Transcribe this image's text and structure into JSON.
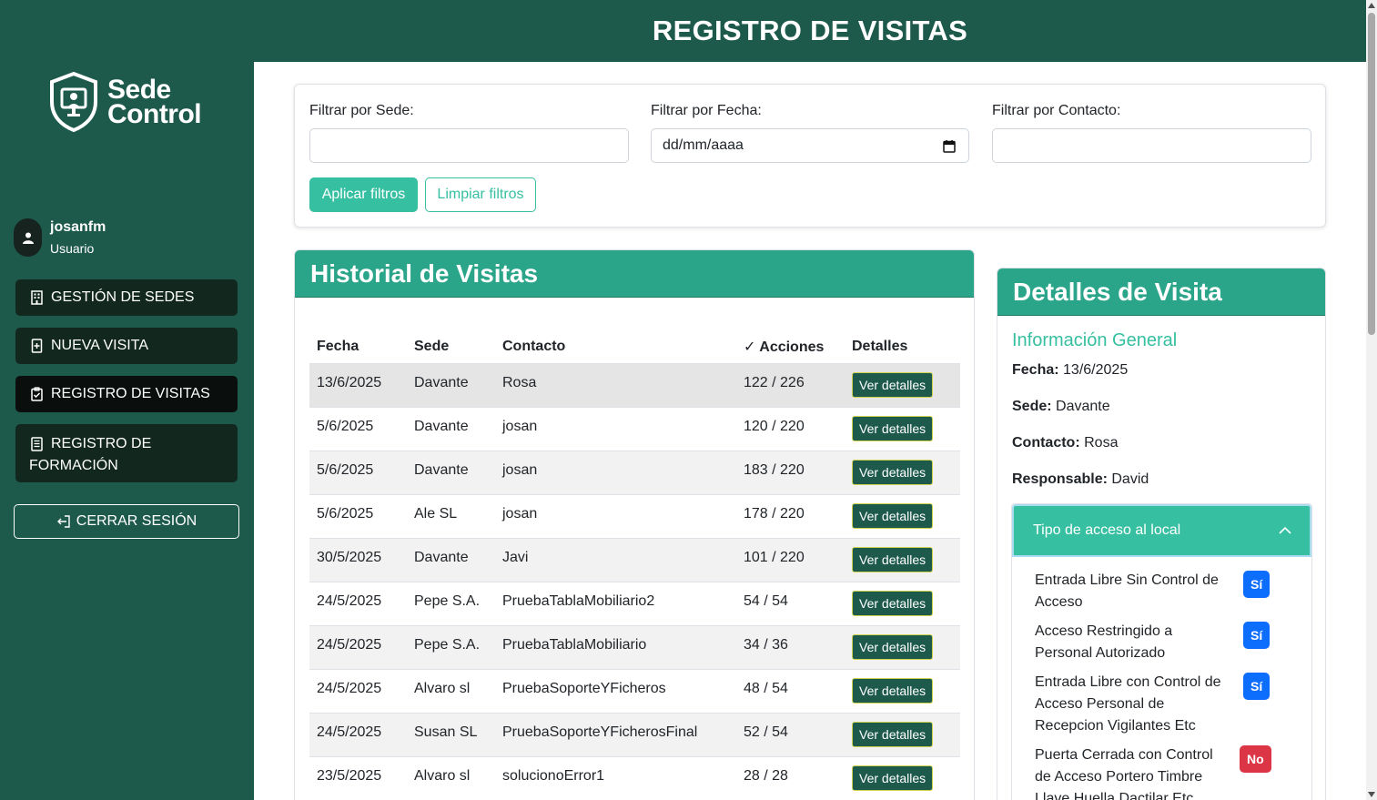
{
  "app": {
    "logo_line1": "Sede",
    "logo_line2": "Control",
    "user_name": "josanfm",
    "user_role": "Usuario",
    "page_title": "REGISTRO DE VISITAS"
  },
  "sidebar": {
    "items": [
      {
        "label": "GESTIÓN DE SEDES",
        "icon": "building-icon"
      },
      {
        "label": "NUEVA VISITA",
        "icon": "file-plus-icon"
      },
      {
        "label": "REGISTRO DE VISITAS",
        "icon": "clipboard-icon",
        "active": true
      },
      {
        "label": "REGISTRO DE FORMACIÓN",
        "icon": "list-document-icon"
      }
    ],
    "logout_label": "CERRAR SESIÓN"
  },
  "filters": {
    "sede_label": "Filtrar por Sede:",
    "fecha_label": "Filtrar por Fecha:",
    "fecha_placeholder": "dd/mm/aaaa",
    "contacto_label": "Filtrar por Contacto:",
    "apply_label": "Aplicar filtros",
    "clear_label": "Limpiar filtros"
  },
  "history": {
    "title": "Historial de Visitas",
    "columns": [
      "Fecha",
      "Sede",
      "Contacto",
      "✓ Acciones",
      "Detalles"
    ],
    "details_label": "Ver detalles",
    "rows": [
      {
        "fecha": "13/6/2025",
        "sede": "Davante",
        "contacto": "Rosa",
        "acciones": "122 / 226"
      },
      {
        "fecha": "5/6/2025",
        "sede": "Davante",
        "contacto": "josan",
        "acciones": "120 / 220"
      },
      {
        "fecha": "5/6/2025",
        "sede": "Davante",
        "contacto": "josan",
        "acciones": "183 / 220"
      },
      {
        "fecha": "5/6/2025",
        "sede": "Ale SL",
        "contacto": "josan",
        "acciones": "178 / 220"
      },
      {
        "fecha": "30/5/2025",
        "sede": "Davante",
        "contacto": "Javi",
        "acciones": "101 / 220"
      },
      {
        "fecha": "24/5/2025",
        "sede": "Pepe S.A.",
        "contacto": "PruebaTablaMobiliario2",
        "acciones": "54 / 54"
      },
      {
        "fecha": "24/5/2025",
        "sede": "Pepe S.A.",
        "contacto": "PruebaTablaMobiliario",
        "acciones": "34 / 36"
      },
      {
        "fecha": "24/5/2025",
        "sede": "Alvaro sl",
        "contacto": "PruebaSoporteYFicheros",
        "acciones": "48 / 54"
      },
      {
        "fecha": "24/5/2025",
        "sede": "Susan SL",
        "contacto": "PruebaSoporteYFicherosFinal",
        "acciones": "52 / 54"
      },
      {
        "fecha": "23/5/2025",
        "sede": "Alvaro sl",
        "contacto": "solucionoError1",
        "acciones": "28 / 28"
      }
    ]
  },
  "details": {
    "title": "Detalles de Visita",
    "section_title": "Información General",
    "fecha_label": "Fecha:",
    "fecha_value": "13/6/2025",
    "sede_label": "Sede:",
    "sede_value": "Davante",
    "contacto_label": "Contacto:",
    "contacto_value": "Rosa",
    "responsable_label": "Responsable:",
    "responsable_value": "David",
    "accordion_title": "Tipo de acceso al local",
    "access_items": [
      {
        "text": "Entrada Libre Sin Control de Acceso",
        "value": "Sí"
      },
      {
        "text": "Acceso Restringido a Personal Autorizado",
        "value": "Sí"
      },
      {
        "text": "Entrada Libre con Control de Acceso Personal de Recepcion Vigilantes Etc",
        "value": "Sí"
      },
      {
        "text": "Puerta Cerrada con Control de Acceso Portero Timbre Llave Huella Dactilar Etc",
        "value": "No"
      }
    ]
  },
  "colors": {
    "sidebar_bg": "#1e5a4c",
    "accent": "#36bfa0",
    "card_header": "#2aa58a",
    "badge_yes": "#0d6efd",
    "badge_no": "#dc3545"
  }
}
